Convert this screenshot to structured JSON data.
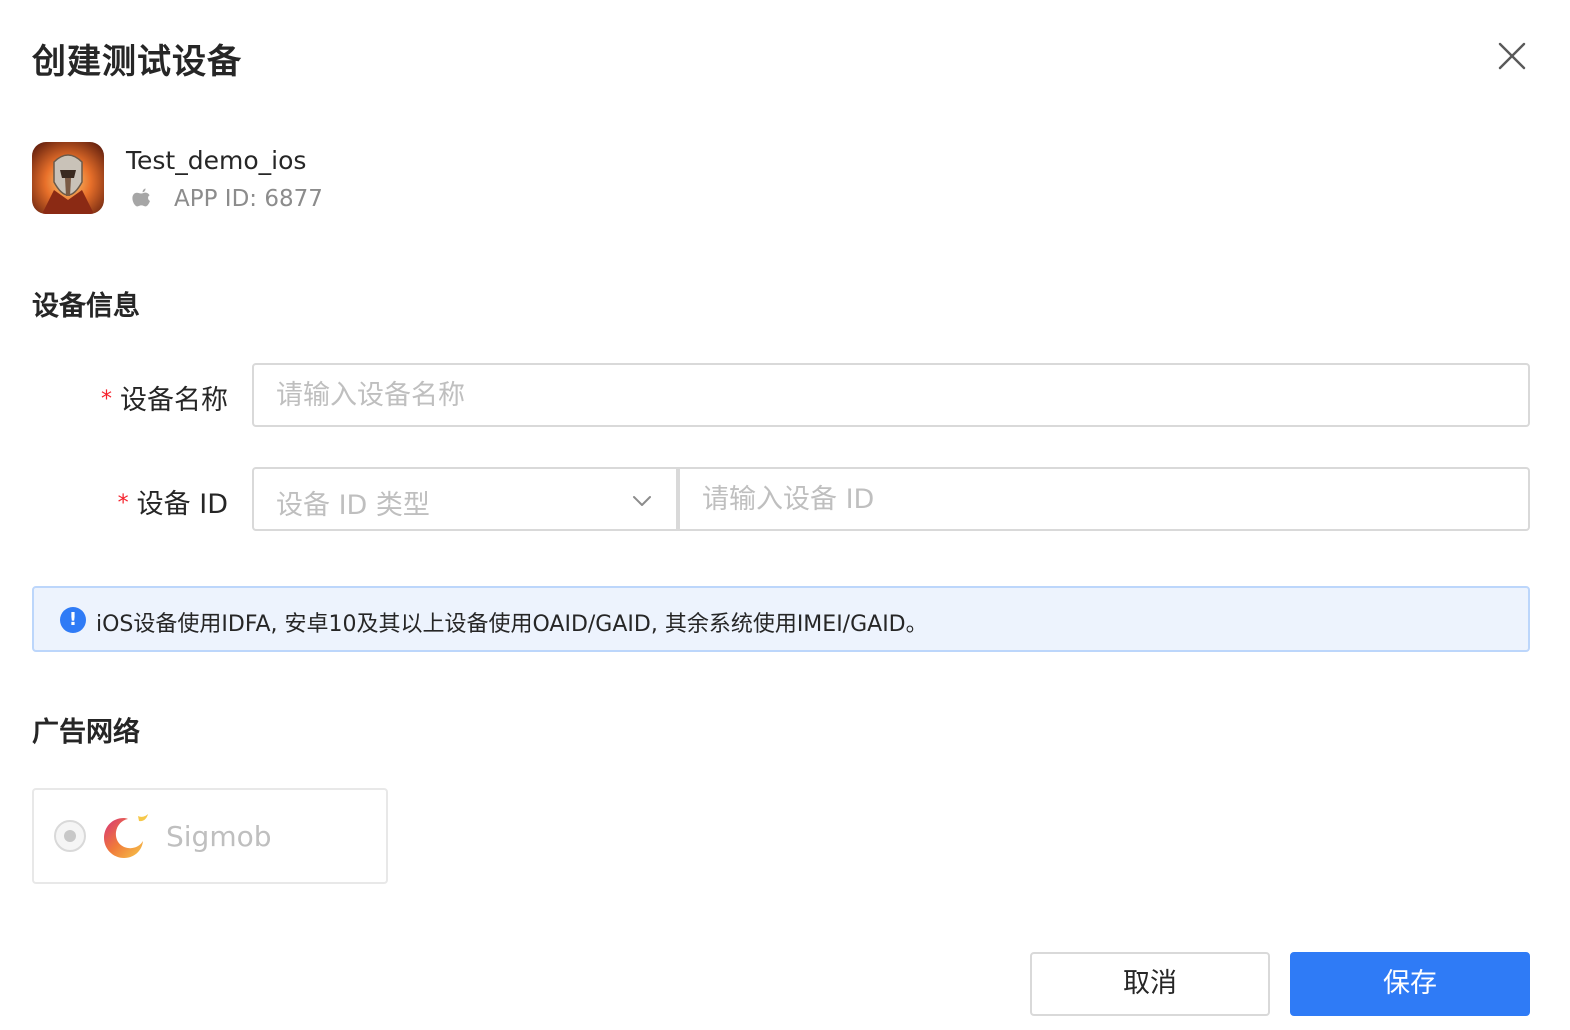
{
  "dialog": {
    "title": "创建测试设备",
    "close_icon": "close-icon"
  },
  "app": {
    "name": "Test_demo_ios",
    "platform_icon": "apple-icon",
    "app_id": "APP ID: 6877"
  },
  "device_section": {
    "title": "设备信息",
    "name_field": {
      "required_mark": "*",
      "label": "设备名称",
      "value": "",
      "placeholder": "请输入设备名称"
    },
    "id_field": {
      "required_mark": "*",
      "label": "设备 ID",
      "type_select_placeholder": "设备 ID 类型",
      "value": "",
      "placeholder": "请输入设备 ID"
    },
    "notice": {
      "icon": "info-icon",
      "text": "iOS设备使用IDFA, 安卓10及其以上设备使用OAID/GAID, 其余系统使用IMEI/GAID。"
    }
  },
  "network_section": {
    "title": "广告网络",
    "networks": [
      {
        "name": "Sigmob",
        "selected": true,
        "disabled": true,
        "logo": "sigmob-logo"
      }
    ]
  },
  "footer": {
    "cancel_label": "取消",
    "save_label": "保存"
  },
  "colors": {
    "primary": "#2f7bf6",
    "required": "#f5222d",
    "alert_bg": "#edf3fd",
    "alert_border": "#bcd6fb"
  }
}
